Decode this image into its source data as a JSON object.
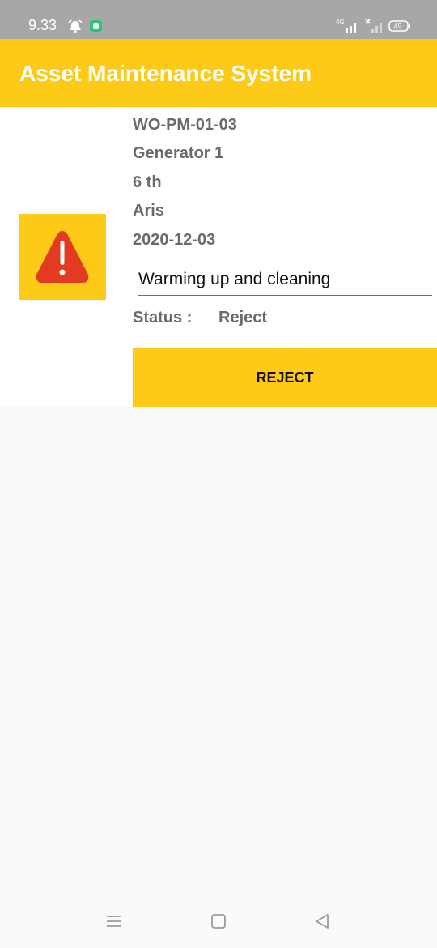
{
  "status_bar": {
    "time": "9.33",
    "network": "4G",
    "battery": "49",
    "icons": [
      "alarm-icon",
      "notification-app-icon",
      "signal-icon",
      "no-signal-icon",
      "battery-icon"
    ]
  },
  "app_bar": {
    "title": "Asset Maintenance System"
  },
  "work_order": {
    "icon": "warning-icon",
    "id": "WO-PM-01-03",
    "asset": "Generator 1",
    "floor": "6 th",
    "person": "Aris",
    "date": "2020-12-03",
    "description": "Warming up and cleaning",
    "status_label": "Status :",
    "status_value": "Reject",
    "button_label": "REJECT"
  },
  "colors": {
    "accent": "#fdcb17",
    "warning_red": "#e33b21",
    "text_gray": "#6a6a6a"
  },
  "nav_bar": {
    "icons": [
      "menu-icon",
      "home-icon",
      "back-icon"
    ]
  }
}
